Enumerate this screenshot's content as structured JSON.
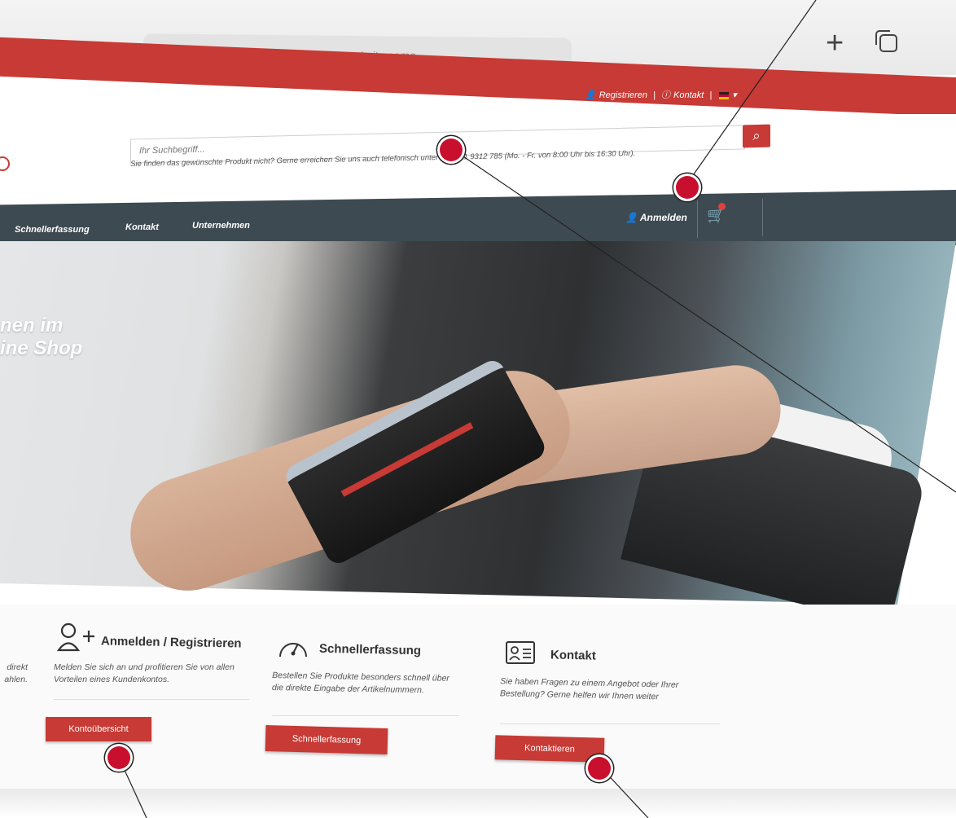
{
  "browser": {
    "address_placeholder": "Search or enter website name"
  },
  "topbar": {
    "register": "Registrieren",
    "separator": "|",
    "contact": "Kontakt"
  },
  "header": {
    "search_placeholder": "Ihr Suchbegriff...",
    "hint": "Sie finden das gewünschte Produkt nicht? Gerne erreichen Sie uns auch telefonisch unter +49 711 9312 785 (Mo. - Fr. von 8:00 Uhr bis 16:30 Uhr)."
  },
  "nav": {
    "items": [
      "Schnellerfassung",
      "Kontakt",
      "Unternehmen"
    ],
    "login": "Anmelden"
  },
  "hero": {
    "line1": "nen im",
    "line2": "ine Shop"
  },
  "features": {
    "left_partial": {
      "line1": "direkt",
      "line2": "ahlen."
    },
    "account": {
      "title": "Anmelden / Registrieren",
      "text": "Melden Sie sich an und profitieren Sie von allen Vorteilen eines Kundenkontos.",
      "button": "Kontoübersicht"
    },
    "quick": {
      "title": "Schnellerfassung",
      "text": "Bestellen Sie Produkte besonders schnell über die direkte Eingabe der Artikelnummern.",
      "button": "Schnellerfassung"
    },
    "contact": {
      "title": "Kontakt",
      "text": "Sie haben Fragen zu einem Angebot oder Ihrer Bestellung? Gerne helfen wir Ihnen weiter",
      "button": "Kontaktieren"
    }
  },
  "colors": {
    "brand_red": "#c73a35",
    "nav_dark": "#3e4a52",
    "callout_red": "#c8102e"
  }
}
